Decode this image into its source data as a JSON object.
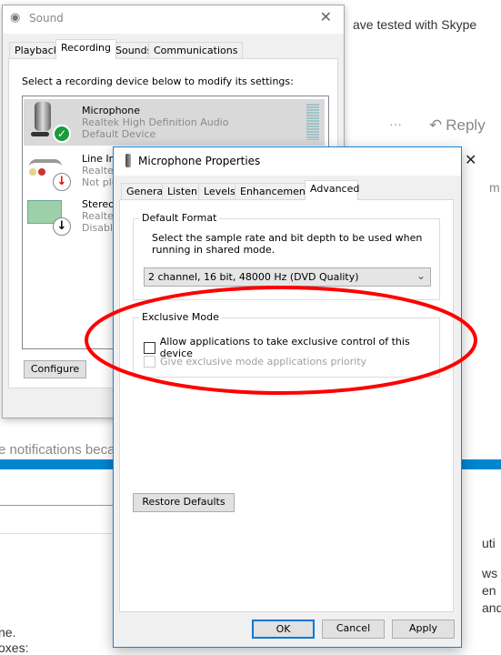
{
  "background": {
    "text_top": "ave tested with Skype",
    "more_label": "···",
    "reply_label": "Reply",
    "right_fragment_m": "m",
    "notifications_text": "e notifications becaus",
    "right_fragments": [
      "uti",
      "ws",
      "en",
      "and"
    ],
    "left_fragments": [
      "ne.",
      "oxes:"
    ],
    "accent_color": "#0086d0"
  },
  "sound": {
    "title": "Sound",
    "tabs": [
      {
        "label": "Playback"
      },
      {
        "label": "Recording",
        "selected": true
      },
      {
        "label": "Sounds"
      },
      {
        "label": "Communications"
      }
    ],
    "instruction": "Select a recording device below to modify its settings:",
    "devices": [
      {
        "name": "Microphone",
        "driver": "Realtek High Definition Audio",
        "status": "Default Device",
        "icon": "microphone-icon",
        "badge": "check"
      },
      {
        "name": "Line In",
        "driver": "Realtek",
        "status": "Not plug",
        "icon": "line-in-icon",
        "badge": "down-red"
      },
      {
        "name": "Stereo M",
        "driver": "Realtek",
        "status": "Disabled",
        "icon": "sound-card-icon",
        "badge": "down-black"
      }
    ],
    "configure_label": "Configure"
  },
  "props": {
    "title": "Microphone Properties",
    "tabs": [
      {
        "label": "General"
      },
      {
        "label": "Listen"
      },
      {
        "label": "Levels"
      },
      {
        "label": "Enhancements"
      },
      {
        "label": "Advanced",
        "selected": true
      }
    ],
    "default_format": {
      "title": "Default Format",
      "description": "Select the sample rate and bit depth to be used when running in shared mode.",
      "selected": "2 channel, 16 bit, 48000 Hz (DVD Quality)"
    },
    "exclusive": {
      "title": "Exclusive Mode",
      "allow_label": "Allow applications to take exclusive control of this device",
      "allow_checked": false,
      "priority_label": "Give exclusive mode applications priority",
      "priority_checked": false,
      "priority_disabled": true
    },
    "restore_label": "Restore Defaults",
    "ok_label": "OK",
    "cancel_label": "Cancel",
    "apply_label": "Apply",
    "highlight_color": "#ff0000"
  }
}
